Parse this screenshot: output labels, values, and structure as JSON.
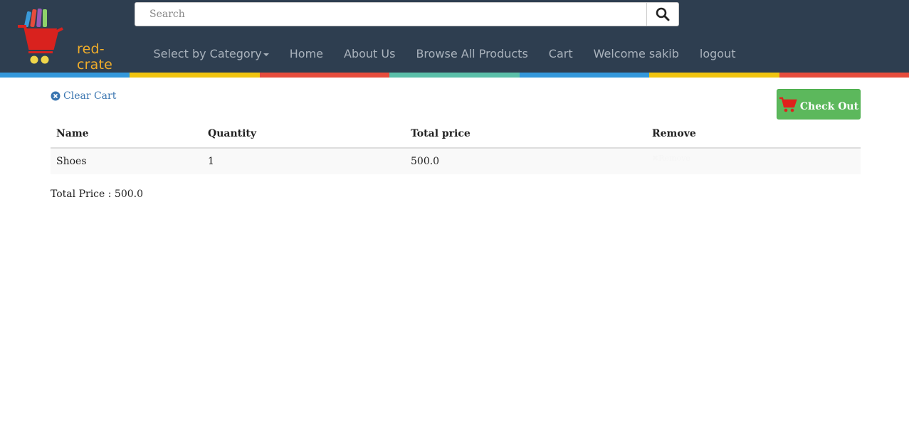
{
  "brand": {
    "name": "red-crate",
    "text_color": "#f0ad2a"
  },
  "search": {
    "placeholder": "Search",
    "value": "",
    "icon": "search-icon"
  },
  "nav": {
    "items": [
      {
        "label": "Select by Category",
        "dropdown": true
      },
      {
        "label": "Home"
      },
      {
        "label": "About Us"
      },
      {
        "label": "Browse All Products"
      },
      {
        "label": "Cart"
      },
      {
        "label": "Welcome sakib"
      },
      {
        "label": "logout"
      }
    ]
  },
  "stripe_colors": [
    "#3498db",
    "#f1c40f",
    "#e74c3c",
    "#5bbfa9",
    "#3498db",
    "#f1c40f",
    "#e74c3c"
  ],
  "cart": {
    "clear_label": "Clear Cart",
    "checkout_label": "Check Out",
    "columns": [
      "Name",
      "Quantity",
      "Total price",
      "Remove"
    ],
    "rows": [
      {
        "name": "Shoes",
        "quantity": "1",
        "total": "500.0",
        "remove": "Remove"
      }
    ],
    "total_text": "Total Price : 500.0"
  },
  "colors": {
    "header_bg": "#2e3e50",
    "checkout_bg": "#5cb85c",
    "link": "#3a75b0",
    "nav_text": "#a9b2bc"
  }
}
